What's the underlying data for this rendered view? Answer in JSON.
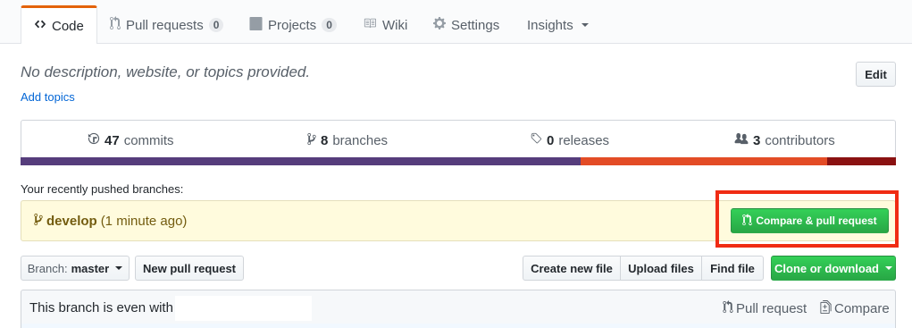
{
  "tabs": [
    {
      "label": "Code",
      "icon": "code-icon",
      "active": true
    },
    {
      "label": "Pull requests",
      "icon": "git-pull-request-icon",
      "count": "0"
    },
    {
      "label": "Projects",
      "icon": "project-icon",
      "count": "0"
    },
    {
      "label": "Wiki",
      "icon": "book-icon"
    },
    {
      "label": "Settings",
      "icon": "gear-icon"
    },
    {
      "label": "Insights",
      "icon": "caret-down-icon"
    }
  ],
  "repo": {
    "description": "No description, website, or topics provided.",
    "add_topics": "Add topics",
    "edit_label": "Edit"
  },
  "summary": {
    "commits": {
      "count": "47",
      "label": "commits"
    },
    "branches": {
      "count": "8",
      "label": "branches"
    },
    "releases": {
      "count": "0",
      "label": "releases"
    },
    "contributors": {
      "count": "3",
      "label": "contributors"
    }
  },
  "language_bar": [
    {
      "color": "#563d7c",
      "fraction": 0.64
    },
    {
      "color": "#e34c26",
      "fraction": 0.281
    },
    {
      "color": "#8a1111",
      "fraction": 0.079
    }
  ],
  "recent": {
    "label": "Your recently pushed branches:",
    "branch": "develop",
    "time": "(1 minute ago)",
    "compare_label": "Compare & pull request"
  },
  "toolbar": {
    "branch_prefix": "Branch:",
    "branch_name": "master",
    "new_pr": "New pull request",
    "create_file": "Create new file",
    "upload_files": "Upload files",
    "find_file": "Find file",
    "clone": "Clone or download"
  },
  "commit_bar": {
    "status": "This branch is even with",
    "pull_request": "Pull request",
    "compare": "Compare"
  },
  "colors": {
    "accent_tab": "#e36209",
    "link": "#0366d6",
    "green": "#28a745",
    "highlight": "#f02c14",
    "flash_bg": "#fffbdd"
  }
}
